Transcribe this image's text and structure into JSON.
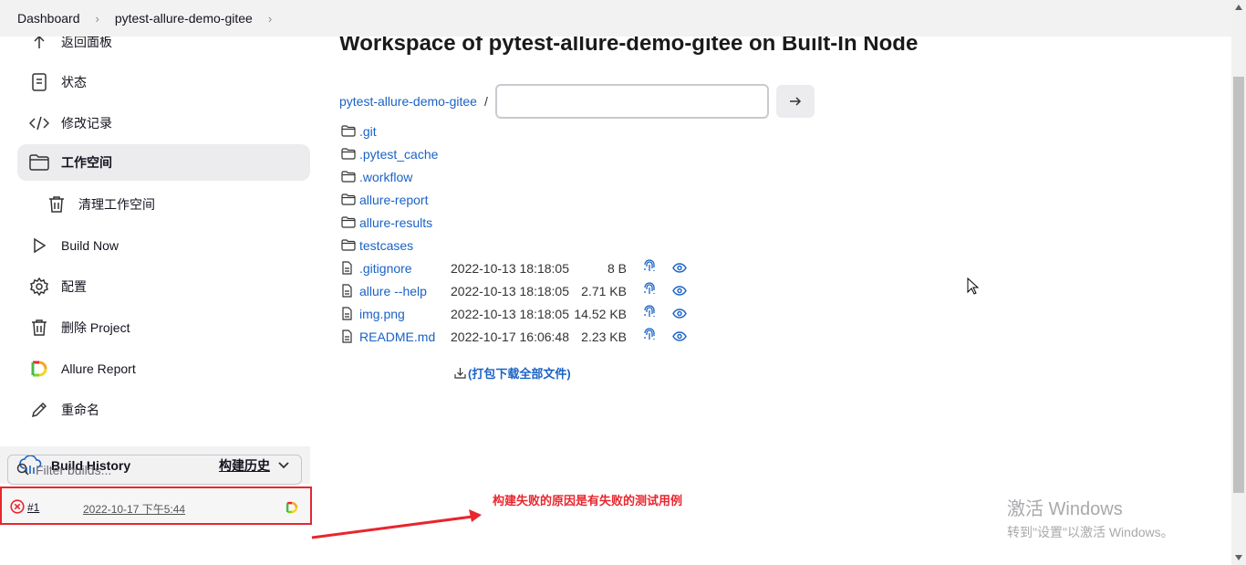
{
  "breadcrumb": [
    {
      "label": "Dashboard"
    },
    {
      "label": "pytest-allure-demo-gitee"
    }
  ],
  "sidebar": {
    "tasks": [
      {
        "label": "返回面板",
        "icon": "arrow-up-icon"
      },
      {
        "label": "状态",
        "icon": "document-icon"
      },
      {
        "label": "修改记录",
        "icon": "code-icon"
      },
      {
        "label": "工作空间",
        "icon": "folder-icon",
        "active": true
      },
      {
        "label": "清理工作空间",
        "icon": "trash-icon"
      },
      {
        "label": "Build Now",
        "icon": "play-icon"
      },
      {
        "label": "配置",
        "icon": "gear-icon"
      },
      {
        "label": "删除 Project",
        "icon": "trash-icon"
      },
      {
        "label": "Allure Report",
        "icon": "allure-icon"
      },
      {
        "label": "重命名",
        "icon": "pencil-icon"
      }
    ]
  },
  "build_history": {
    "title": "Build History",
    "link": "构建历史",
    "filter_placeholder": "Filter builds...",
    "builds": [
      {
        "number": "#1",
        "date": "2022-10-17 下午5:44",
        "status": "failed"
      }
    ]
  },
  "main": {
    "title": "Workspace of pytest-allure-demo-gitee on Built-In Node",
    "path_root": "pytest-allure-demo-gitee",
    "path_sep": "/",
    "path_value": "",
    "folders": [
      ".git",
      ".pytest_cache",
      ".workflow",
      "allure-report",
      "allure-results",
      "testcases"
    ],
    "files": [
      {
        "name": ".gitignore",
        "date": "2022-10-13 18:18:05",
        "size": "8 B"
      },
      {
        "name": "allure --help",
        "date": "2022-10-13 18:18:05",
        "size": "2.71 KB"
      },
      {
        "name": "img.png",
        "date": "2022-10-13 18:18:05",
        "size": "14.52 KB"
      },
      {
        "name": "README.md",
        "date": "2022-10-17 16:06:48",
        "size": "2.23 KB"
      }
    ],
    "download_label": "(打包下载全部文件)"
  },
  "annotation": "构建失败的原因是有失败的测试用例",
  "watermark": {
    "line1": "激活 Windows",
    "line2": "转到\"设置\"以激活 Windows。"
  },
  "colors": {
    "link": "#1a62c6",
    "annotation": "#e8262e",
    "failed": "#e8262e"
  }
}
